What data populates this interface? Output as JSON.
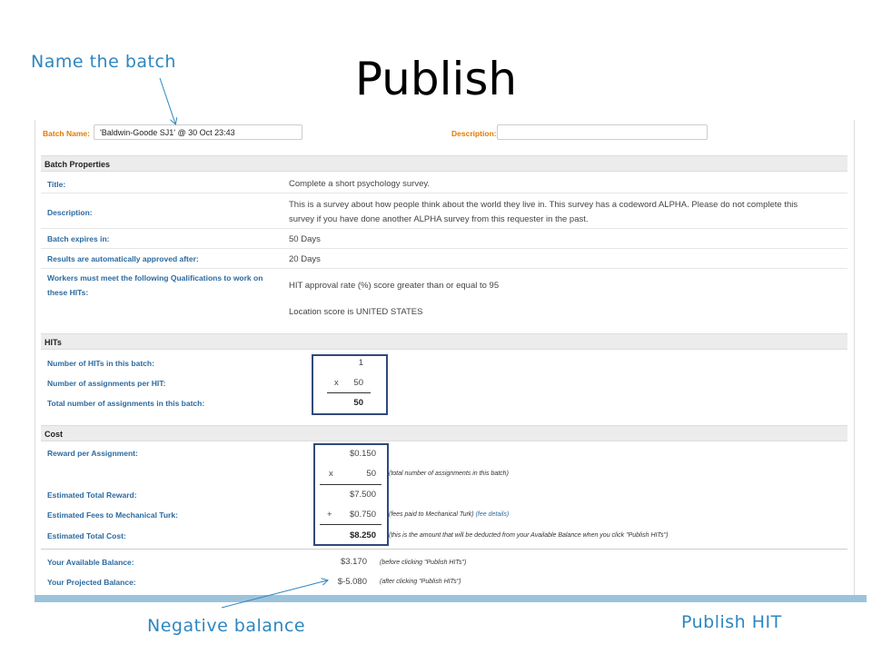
{
  "slide": {
    "title": "Publish",
    "annotations": {
      "name_batch": "Name the batch",
      "negative_balance": "Negative balance",
      "publish_hit": "Publish HIT"
    }
  },
  "batch": {
    "name_label": "Batch Name:",
    "name_value": "'Baldwin-Goode SJ1' @ 30 Oct 23:43",
    "description_label": "Description:",
    "description_value": ""
  },
  "properties": {
    "header": "Batch Properties",
    "title_label": "Title:",
    "title_value": "Complete a short psychology survey.",
    "description_label": "Description:",
    "description_line1": "This is a survey about how people think about the world they live in. This survey has a codeword ALPHA. Please do not complete this",
    "description_line2": "survey if you have done another ALPHA survey from this requester in the past.",
    "expires_label": "Batch expires in:",
    "expires_value": "50 Days",
    "approved_label": "Results are automatically approved after:",
    "approved_value": "20 Days",
    "qual_label_line1": "Workers must meet the following Qualifications to work on",
    "qual_label_line2": "these HITs:",
    "qual_value1": "HIT approval rate (%) score greater than or equal to 95",
    "qual_value2": "Location score is UNITED STATES"
  },
  "hits": {
    "header": "HITs",
    "num_hits_label": "Number of HITs in this batch:",
    "num_hits_value": "1",
    "assign_per_hit_label": "Number of assignments per HIT:",
    "times_sign": "x",
    "assign_per_hit_value": "50",
    "total_assign_label": "Total number of assignments in this batch:",
    "total_assign_value": "50"
  },
  "cost": {
    "header": "Cost",
    "reward_label": "Reward per Assignment:",
    "reward_value": "$0.150",
    "times_sign": "x",
    "reward_multiplier": "50",
    "reward_multiplier_note": "(total number of assignments in this batch)",
    "est_reward_label": "Estimated Total Reward:",
    "est_reward_value": "$7.500",
    "fees_label": "Estimated Fees to Mechanical Turk:",
    "plus_sign": "+",
    "fees_value": "$0.750",
    "fees_note": "(fees paid to Mechanical Turk)",
    "fees_link": "(fee details)",
    "total_cost_label": "Estimated Total Cost:",
    "total_cost_value": "$8.250",
    "total_cost_note": "(this is the amount that will be deducted from your Available Balance when you click \"Publish HITs\")"
  },
  "balance": {
    "available_label": "Your Available Balance:",
    "available_value": "$3.170",
    "available_note": "(before clicking \"Publish HITs\")",
    "projected_label": "Your Projected Balance:",
    "projected_value": "$-5.080",
    "projected_note": "(after clicking \"Publish HITs\")"
  },
  "colors": {
    "annotation": "#2e86c1",
    "label_blue": "#2c6aa0",
    "label_orange": "#e07b00",
    "highlight_box": "#2f4a7a",
    "bottom_bar": "#9cc3dc"
  }
}
